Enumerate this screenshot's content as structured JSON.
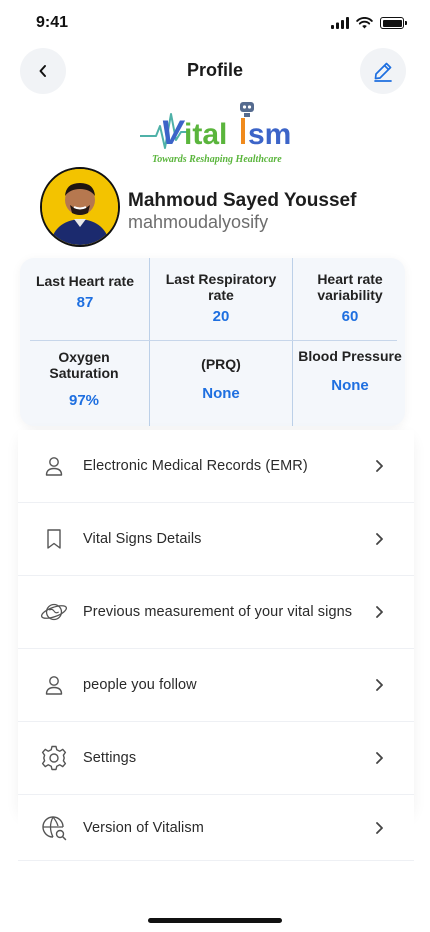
{
  "status_bar": {
    "time": "9:41"
  },
  "header": {
    "title": "Profile"
  },
  "logo": {
    "brand_text": "ital sm",
    "tagline": "Towards Reshaping Healthcare",
    "colors": {
      "blue": "#2b57c9",
      "green": "#5ab53c",
      "orange": "#f08a1c"
    }
  },
  "user": {
    "name": "Mahmoud Sayed Youssef",
    "handle": "mahmoudalyosify"
  },
  "vitals": [
    {
      "label": "Last Heart rate",
      "value": "87"
    },
    {
      "label": "Last Respiratory rate",
      "value": "20"
    },
    {
      "label": "Heart rate variability",
      "value": "60"
    },
    {
      "label": "Oxygen Saturation",
      "value": "97%"
    },
    {
      "label": "(PRQ)",
      "value": "None"
    },
    {
      "label": "Blood Pressure",
      "value": "None"
    }
  ],
  "menu": [
    {
      "label": "Electronic Medical Records (EMR)",
      "icon": "user-icon"
    },
    {
      "label": "Vital Signs Details",
      "icon": "bookmark-icon"
    },
    {
      "label": "Previous measurement of your vital signs",
      "icon": "planet-icon"
    },
    {
      "label": "people you follow",
      "icon": "user-icon"
    },
    {
      "label": "Settings",
      "icon": "gear-icon"
    },
    {
      "label": "Version of Vitalism",
      "icon": "globe-search-icon"
    }
  ],
  "colors": {
    "accent": "#1e6fe0",
    "edit_icon": "#1e6fe0"
  }
}
